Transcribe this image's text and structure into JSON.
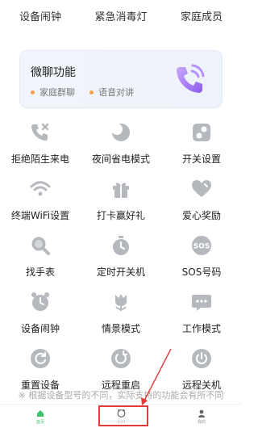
{
  "top_row": [
    "设备闹钟",
    "紧急消毒灯",
    "家庭成员"
  ],
  "promo": {
    "title": "微聊功能",
    "tags": [
      "家庭群聊",
      "语音对讲"
    ],
    "icon": "phone-wave-icon",
    "accent": "#9b6cf0"
  },
  "features": [
    {
      "label": "拒绝陌生来电",
      "icon": "reject-call-icon"
    },
    {
      "label": "夜间省电模式",
      "icon": "moon-icon"
    },
    {
      "label": "开关设置",
      "icon": "toggle-icon"
    },
    {
      "label": "终端WiFi设置",
      "icon": "wifi-icon"
    },
    {
      "label": "打卡赢好礼",
      "icon": "gift-icon"
    },
    {
      "label": "爱心奖励",
      "icon": "heart-icon"
    },
    {
      "label": "找手表",
      "icon": "magnifier-icon"
    },
    {
      "label": "定时开关机",
      "icon": "timer-icon"
    },
    {
      "label": "SOS号码",
      "icon": "sos-icon"
    },
    {
      "label": "设备闹钟",
      "icon": "alarm-icon"
    },
    {
      "label": "情景模式",
      "icon": "tulip-icon"
    },
    {
      "label": "工作模式",
      "icon": "message-icon"
    },
    {
      "label": "重置设备",
      "icon": "reset-icon"
    },
    {
      "label": "远程重启",
      "icon": "restart-icon"
    },
    {
      "label": "远程关机",
      "icon": "power-icon"
    }
  ],
  "note": "※ 根据设备型号的不同，实际支持的功能会有所不同",
  "tabbar": [
    {
      "label": "首页",
      "icon": "home-icon",
      "active": true
    },
    {
      "label": "小川",
      "icon": "bear-icon",
      "active": false
    },
    {
      "label": "我的",
      "icon": "person-icon",
      "active": false
    }
  ],
  "colors": {
    "icon_gray": "#b5b8bd",
    "active_green": "#3cc26a",
    "annotation_red": "#e53a3a"
  }
}
